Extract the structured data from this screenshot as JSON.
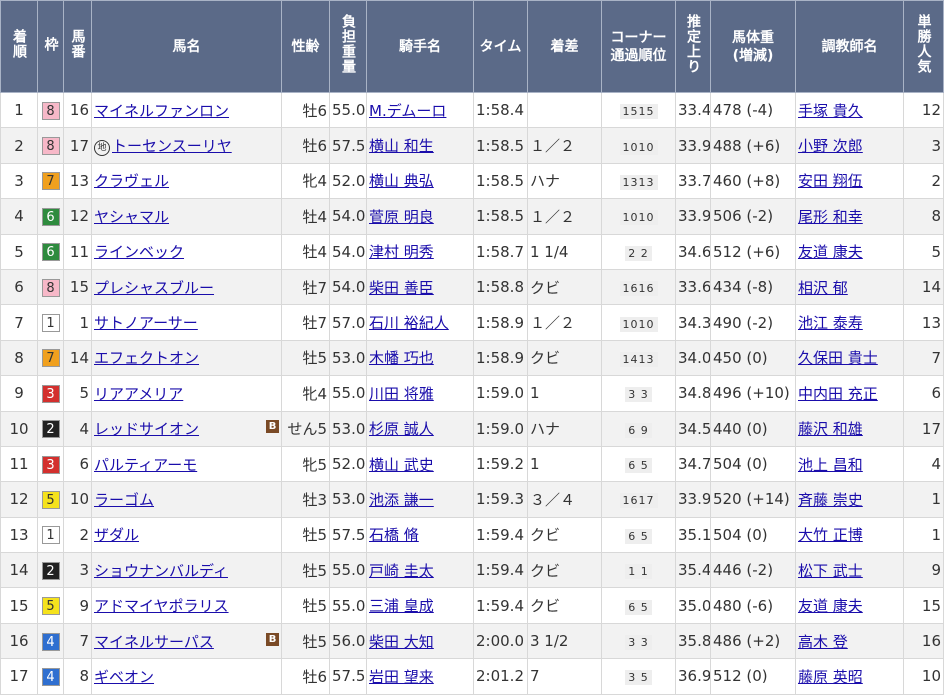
{
  "headers": {
    "rank": "着順",
    "frame": "枠",
    "number": "馬番",
    "horse": "馬名",
    "sexage": "性齢",
    "weight": "負担重量",
    "jockey": "騎手名",
    "time": "タイム",
    "margin": "着差",
    "corner_top": "コーナー",
    "corner_bottom": "通過順位",
    "last3f": "推定上り",
    "body_top": "馬体重",
    "body_bottom": "(増減)",
    "trainer": "調教師名",
    "odds": "単勝人気"
  },
  "colors": {
    "header_bg": "#5b6a88",
    "link": "#1a0dab",
    "frames": {
      "1": {
        "bg": "#ffffff",
        "fg": "#333333"
      },
      "2": {
        "bg": "#222222",
        "fg": "#ffffff"
      },
      "3": {
        "bg": "#d3302e",
        "fg": "#ffffff"
      },
      "4": {
        "bg": "#2f6fd0",
        "fg": "#ffffff"
      },
      "5": {
        "bg": "#f5e21c",
        "fg": "#333333"
      },
      "6": {
        "bg": "#2e8b3e",
        "fg": "#ffffff"
      },
      "7": {
        "bg": "#f0a01e",
        "fg": "#333333"
      },
      "8": {
        "bg": "#f7b8c8",
        "fg": "#333333"
      }
    }
  },
  "badges": {
    "blinker": "B",
    "local": "地"
  },
  "rows": [
    {
      "rank": "1",
      "frame": "8",
      "num": "16",
      "horse": "マイネルファンロン",
      "blinker": false,
      "local": false,
      "sexage": "牡6",
      "weight": "55.0",
      "jockey": "M.デムーロ",
      "time": "1:58.4",
      "margin": "",
      "corner": "1515",
      "last3f": "33.4",
      "body": "478 (-4)",
      "trainer": "手塚 貴久",
      "pop": "12"
    },
    {
      "rank": "2",
      "frame": "8",
      "num": "17",
      "horse": "トーセンスーリヤ",
      "blinker": false,
      "local": true,
      "sexage": "牡6",
      "weight": "57.5",
      "jockey": "横山 和生",
      "time": "1:58.5",
      "margin": "１／２",
      "corner": "1010",
      "last3f": "33.9",
      "body": "488 (+6)",
      "trainer": "小野 次郎",
      "pop": "3"
    },
    {
      "rank": "3",
      "frame": "7",
      "num": "13",
      "horse": "クラヴェル",
      "blinker": false,
      "local": false,
      "sexage": "牝4",
      "weight": "52.0",
      "jockey": "横山 典弘",
      "time": "1:58.5",
      "margin": "ハナ",
      "corner": "1313",
      "last3f": "33.7",
      "body": "460 (+8)",
      "trainer": "安田 翔伍",
      "pop": "2"
    },
    {
      "rank": "4",
      "frame": "6",
      "num": "12",
      "horse": "ヤシャマル",
      "blinker": false,
      "local": false,
      "sexage": "牡4",
      "weight": "54.0",
      "jockey": "菅原 明良",
      "time": "1:58.5",
      "margin": "１／２",
      "corner": "1010",
      "last3f": "33.9",
      "body": "506 (-2)",
      "trainer": "尾形 和幸",
      "pop": "8"
    },
    {
      "rank": "5",
      "frame": "6",
      "num": "11",
      "horse": "ラインベック",
      "blinker": false,
      "local": false,
      "sexage": "牡4",
      "weight": "54.0",
      "jockey": "津村 明秀",
      "time": "1:58.7",
      "margin": "1 1/4",
      "corner": "2 2",
      "last3f": "34.6",
      "body": "512 (+6)",
      "trainer": "友道 康夫",
      "pop": "5"
    },
    {
      "rank": "6",
      "frame": "8",
      "num": "15",
      "horse": "プレシャスブルー",
      "blinker": false,
      "local": false,
      "sexage": "牡7",
      "weight": "54.0",
      "jockey": "柴田 善臣",
      "time": "1:58.8",
      "margin": "クビ",
      "corner": "1616",
      "last3f": "33.6",
      "body": "434 (-8)",
      "trainer": "相沢 郁",
      "pop": "14"
    },
    {
      "rank": "7",
      "frame": "1",
      "num": "1",
      "horse": "サトノアーサー",
      "blinker": false,
      "local": false,
      "sexage": "牡7",
      "weight": "57.0",
      "jockey": "石川 裕紀人",
      "time": "1:58.9",
      "margin": "１／２",
      "corner": "1010",
      "last3f": "34.3",
      "body": "490 (-2)",
      "trainer": "池江 泰寿",
      "pop": "13"
    },
    {
      "rank": "8",
      "frame": "7",
      "num": "14",
      "horse": "エフェクトオン",
      "blinker": false,
      "local": false,
      "sexage": "牡5",
      "weight": "53.0",
      "jockey": "木幡 巧也",
      "time": "1:58.9",
      "margin": "クビ",
      "corner": "1413",
      "last3f": "34.0",
      "body": "450 (0)",
      "trainer": "久保田 貴士",
      "pop": "7"
    },
    {
      "rank": "9",
      "frame": "3",
      "num": "5",
      "horse": "リアアメリア",
      "blinker": false,
      "local": false,
      "sexage": "牝4",
      "weight": "55.0",
      "jockey": "川田 将雅",
      "time": "1:59.0",
      "margin": "1",
      "corner": "3 3",
      "last3f": "34.8",
      "body": "496 (+10)",
      "trainer": "中内田 充正",
      "pop": "6"
    },
    {
      "rank": "10",
      "frame": "2",
      "num": "4",
      "horse": "レッドサイオン",
      "blinker": true,
      "local": false,
      "sexage": "せん5",
      "weight": "53.0",
      "jockey": "杉原 誠人",
      "time": "1:59.0",
      "margin": "ハナ",
      "corner": "6 9",
      "last3f": "34.5",
      "body": "440 (0)",
      "trainer": "藤沢 和雄",
      "pop": "17"
    },
    {
      "rank": "11",
      "frame": "3",
      "num": "6",
      "horse": "パルティアーモ",
      "blinker": false,
      "local": false,
      "sexage": "牝5",
      "weight": "52.0",
      "jockey": "横山 武史",
      "time": "1:59.2",
      "margin": "1",
      "corner": "6 5",
      "last3f": "34.7",
      "body": "504 (0)",
      "trainer": "池上 昌和",
      "pop": "4"
    },
    {
      "rank": "12",
      "frame": "5",
      "num": "10",
      "horse": "ラーゴム",
      "blinker": false,
      "local": false,
      "sexage": "牡3",
      "weight": "53.0",
      "jockey": "池添 謙一",
      "time": "1:59.3",
      "margin": "３／４",
      "corner": "1617",
      "last3f": "33.9",
      "body": "520 (+14)",
      "trainer": "斉藤 崇史",
      "pop": "1"
    },
    {
      "rank": "13",
      "frame": "1",
      "num": "2",
      "horse": "ザダル",
      "blinker": false,
      "local": false,
      "sexage": "牡5",
      "weight": "57.5",
      "jockey": "石橋 脩",
      "time": "1:59.4",
      "margin": "クビ",
      "corner": "6 5",
      "last3f": "35.1",
      "body": "504 (0)",
      "trainer": "大竹 正博",
      "pop": "1"
    },
    {
      "rank": "14",
      "frame": "2",
      "num": "3",
      "horse": "ショウナンバルディ",
      "blinker": false,
      "local": false,
      "sexage": "牡5",
      "weight": "55.0",
      "jockey": "戸崎 圭太",
      "time": "1:59.4",
      "margin": "クビ",
      "corner": "1 1",
      "last3f": "35.4",
      "body": "446 (-2)",
      "trainer": "松下 武士",
      "pop": "9"
    },
    {
      "rank": "15",
      "frame": "5",
      "num": "9",
      "horse": "アドマイヤポラリス",
      "blinker": false,
      "local": false,
      "sexage": "牡5",
      "weight": "55.0",
      "jockey": "三浦 皇成",
      "time": "1:59.4",
      "margin": "クビ",
      "corner": "6 5",
      "last3f": "35.0",
      "body": "480 (-6)",
      "trainer": "友道 康夫",
      "pop": "15"
    },
    {
      "rank": "16",
      "frame": "4",
      "num": "7",
      "horse": "マイネルサーパス",
      "blinker": true,
      "local": false,
      "sexage": "牡5",
      "weight": "56.0",
      "jockey": "柴田 大知",
      "time": "2:00.0",
      "margin": "3 1/2",
      "corner": "3 3",
      "last3f": "35.8",
      "body": "486 (+2)",
      "trainer": "高木 登",
      "pop": "16"
    },
    {
      "rank": "17",
      "frame": "4",
      "num": "8",
      "horse": "ギベオン",
      "blinker": false,
      "local": false,
      "sexage": "牡6",
      "weight": "57.5",
      "jockey": "岩田 望来",
      "time": "2:01.2",
      "margin": "7",
      "corner": "3 5",
      "last3f": "36.9",
      "body": "512 (0)",
      "trainer": "藤原 英昭",
      "pop": "10"
    }
  ]
}
